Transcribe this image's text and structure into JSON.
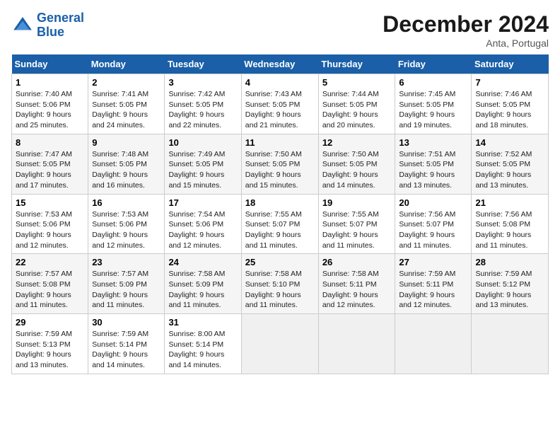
{
  "header": {
    "logo_line1": "General",
    "logo_line2": "Blue",
    "month_title": "December 2024",
    "location": "Anta, Portugal"
  },
  "weekdays": [
    "Sunday",
    "Monday",
    "Tuesday",
    "Wednesday",
    "Thursday",
    "Friday",
    "Saturday"
  ],
  "days": [
    {
      "num": "",
      "info": ""
    },
    {
      "num": "",
      "info": ""
    },
    {
      "num": "",
      "info": ""
    },
    {
      "num": "",
      "info": ""
    },
    {
      "num": "",
      "info": ""
    },
    {
      "num": "",
      "info": ""
    },
    {
      "num": "7",
      "info": "Sunrise: 7:46 AM\nSunset: 5:05 PM\nDaylight: 9 hours\nand 18 minutes."
    },
    {
      "num": "1",
      "info": "Sunrise: 7:40 AM\nSunset: 5:06 PM\nDaylight: 9 hours\nand 25 minutes."
    },
    {
      "num": "2",
      "info": "Sunrise: 7:41 AM\nSunset: 5:05 PM\nDaylight: 9 hours\nand 24 minutes."
    },
    {
      "num": "3",
      "info": "Sunrise: 7:42 AM\nSunset: 5:05 PM\nDaylight: 9 hours\nand 22 minutes."
    },
    {
      "num": "4",
      "info": "Sunrise: 7:43 AM\nSunset: 5:05 PM\nDaylight: 9 hours\nand 21 minutes."
    },
    {
      "num": "5",
      "info": "Sunrise: 7:44 AM\nSunset: 5:05 PM\nDaylight: 9 hours\nand 20 minutes."
    },
    {
      "num": "6",
      "info": "Sunrise: 7:45 AM\nSunset: 5:05 PM\nDaylight: 9 hours\nand 19 minutes."
    },
    {
      "num": "7",
      "info": "Sunrise: 7:46 AM\nSunset: 5:05 PM\nDaylight: 9 hours\nand 18 minutes."
    },
    {
      "num": "8",
      "info": "Sunrise: 7:47 AM\nSunset: 5:05 PM\nDaylight: 9 hours\nand 17 minutes."
    },
    {
      "num": "9",
      "info": "Sunrise: 7:48 AM\nSunset: 5:05 PM\nDaylight: 9 hours\nand 16 minutes."
    },
    {
      "num": "10",
      "info": "Sunrise: 7:49 AM\nSunset: 5:05 PM\nDaylight: 9 hours\nand 15 minutes."
    },
    {
      "num": "11",
      "info": "Sunrise: 7:50 AM\nSunset: 5:05 PM\nDaylight: 9 hours\nand 15 minutes."
    },
    {
      "num": "12",
      "info": "Sunrise: 7:50 AM\nSunset: 5:05 PM\nDaylight: 9 hours\nand 14 minutes."
    },
    {
      "num": "13",
      "info": "Sunrise: 7:51 AM\nSunset: 5:05 PM\nDaylight: 9 hours\nand 13 minutes."
    },
    {
      "num": "14",
      "info": "Sunrise: 7:52 AM\nSunset: 5:05 PM\nDaylight: 9 hours\nand 13 minutes."
    },
    {
      "num": "15",
      "info": "Sunrise: 7:53 AM\nSunset: 5:06 PM\nDaylight: 9 hours\nand 12 minutes."
    },
    {
      "num": "16",
      "info": "Sunrise: 7:53 AM\nSunset: 5:06 PM\nDaylight: 9 hours\nand 12 minutes."
    },
    {
      "num": "17",
      "info": "Sunrise: 7:54 AM\nSunset: 5:06 PM\nDaylight: 9 hours\nand 12 minutes."
    },
    {
      "num": "18",
      "info": "Sunrise: 7:55 AM\nSunset: 5:07 PM\nDaylight: 9 hours\nand 11 minutes."
    },
    {
      "num": "19",
      "info": "Sunrise: 7:55 AM\nSunset: 5:07 PM\nDaylight: 9 hours\nand 11 minutes."
    },
    {
      "num": "20",
      "info": "Sunrise: 7:56 AM\nSunset: 5:07 PM\nDaylight: 9 hours\nand 11 minutes."
    },
    {
      "num": "21",
      "info": "Sunrise: 7:56 AM\nSunset: 5:08 PM\nDaylight: 9 hours\nand 11 minutes."
    },
    {
      "num": "22",
      "info": "Sunrise: 7:57 AM\nSunset: 5:08 PM\nDaylight: 9 hours\nand 11 minutes."
    },
    {
      "num": "23",
      "info": "Sunrise: 7:57 AM\nSunset: 5:09 PM\nDaylight: 9 hours\nand 11 minutes."
    },
    {
      "num": "24",
      "info": "Sunrise: 7:58 AM\nSunset: 5:09 PM\nDaylight: 9 hours\nand 11 minutes."
    },
    {
      "num": "25",
      "info": "Sunrise: 7:58 AM\nSunset: 5:10 PM\nDaylight: 9 hours\nand 11 minutes."
    },
    {
      "num": "26",
      "info": "Sunrise: 7:58 AM\nSunset: 5:11 PM\nDaylight: 9 hours\nand 12 minutes."
    },
    {
      "num": "27",
      "info": "Sunrise: 7:59 AM\nSunset: 5:11 PM\nDaylight: 9 hours\nand 12 minutes."
    },
    {
      "num": "28",
      "info": "Sunrise: 7:59 AM\nSunset: 5:12 PM\nDaylight: 9 hours\nand 13 minutes."
    },
    {
      "num": "29",
      "info": "Sunrise: 7:59 AM\nSunset: 5:13 PM\nDaylight: 9 hours\nand 13 minutes."
    },
    {
      "num": "30",
      "info": "Sunrise: 7:59 AM\nSunset: 5:14 PM\nDaylight: 9 hours\nand 14 minutes."
    },
    {
      "num": "31",
      "info": "Sunrise: 8:00 AM\nSunset: 5:14 PM\nDaylight: 9 hours\nand 14 minutes."
    },
    {
      "num": "",
      "info": ""
    },
    {
      "num": "",
      "info": ""
    },
    {
      "num": "",
      "info": ""
    },
    {
      "num": "",
      "info": ""
    }
  ],
  "grid": [
    [
      {
        "num": "1",
        "info": "Sunrise: 7:40 AM\nSunset: 5:06 PM\nDaylight: 9 hours\nand 25 minutes."
      },
      {
        "num": "2",
        "info": "Sunrise: 7:41 AM\nSunset: 5:05 PM\nDaylight: 9 hours\nand 24 minutes."
      },
      {
        "num": "3",
        "info": "Sunrise: 7:42 AM\nSunset: 5:05 PM\nDaylight: 9 hours\nand 22 minutes."
      },
      {
        "num": "4",
        "info": "Sunrise: 7:43 AM\nSunset: 5:05 PM\nDaylight: 9 hours\nand 21 minutes."
      },
      {
        "num": "5",
        "info": "Sunrise: 7:44 AM\nSunset: 5:05 PM\nDaylight: 9 hours\nand 20 minutes."
      },
      {
        "num": "6",
        "info": "Sunrise: 7:45 AM\nSunset: 5:05 PM\nDaylight: 9 hours\nand 19 minutes."
      },
      {
        "num": "7",
        "info": "Sunrise: 7:46 AM\nSunset: 5:05 PM\nDaylight: 9 hours\nand 18 minutes."
      }
    ],
    [
      {
        "num": "8",
        "info": "Sunrise: 7:47 AM\nSunset: 5:05 PM\nDaylight: 9 hours\nand 17 minutes."
      },
      {
        "num": "9",
        "info": "Sunrise: 7:48 AM\nSunset: 5:05 PM\nDaylight: 9 hours\nand 16 minutes."
      },
      {
        "num": "10",
        "info": "Sunrise: 7:49 AM\nSunset: 5:05 PM\nDaylight: 9 hours\nand 15 minutes."
      },
      {
        "num": "11",
        "info": "Sunrise: 7:50 AM\nSunset: 5:05 PM\nDaylight: 9 hours\nand 15 minutes."
      },
      {
        "num": "12",
        "info": "Sunrise: 7:50 AM\nSunset: 5:05 PM\nDaylight: 9 hours\nand 14 minutes."
      },
      {
        "num": "13",
        "info": "Sunrise: 7:51 AM\nSunset: 5:05 PM\nDaylight: 9 hours\nand 13 minutes."
      },
      {
        "num": "14",
        "info": "Sunrise: 7:52 AM\nSunset: 5:05 PM\nDaylight: 9 hours\nand 13 minutes."
      }
    ],
    [
      {
        "num": "15",
        "info": "Sunrise: 7:53 AM\nSunset: 5:06 PM\nDaylight: 9 hours\nand 12 minutes."
      },
      {
        "num": "16",
        "info": "Sunrise: 7:53 AM\nSunset: 5:06 PM\nDaylight: 9 hours\nand 12 minutes."
      },
      {
        "num": "17",
        "info": "Sunrise: 7:54 AM\nSunset: 5:06 PM\nDaylight: 9 hours\nand 12 minutes."
      },
      {
        "num": "18",
        "info": "Sunrise: 7:55 AM\nSunset: 5:07 PM\nDaylight: 9 hours\nand 11 minutes."
      },
      {
        "num": "19",
        "info": "Sunrise: 7:55 AM\nSunset: 5:07 PM\nDaylight: 9 hours\nand 11 minutes."
      },
      {
        "num": "20",
        "info": "Sunrise: 7:56 AM\nSunset: 5:07 PM\nDaylight: 9 hours\nand 11 minutes."
      },
      {
        "num": "21",
        "info": "Sunrise: 7:56 AM\nSunset: 5:08 PM\nDaylight: 9 hours\nand 11 minutes."
      }
    ],
    [
      {
        "num": "22",
        "info": "Sunrise: 7:57 AM\nSunset: 5:08 PM\nDaylight: 9 hours\nand 11 minutes."
      },
      {
        "num": "23",
        "info": "Sunrise: 7:57 AM\nSunset: 5:09 PM\nDaylight: 9 hours\nand 11 minutes."
      },
      {
        "num": "24",
        "info": "Sunrise: 7:58 AM\nSunset: 5:09 PM\nDaylight: 9 hours\nand 11 minutes."
      },
      {
        "num": "25",
        "info": "Sunrise: 7:58 AM\nSunset: 5:10 PM\nDaylight: 9 hours\nand 11 minutes."
      },
      {
        "num": "26",
        "info": "Sunrise: 7:58 AM\nSunset: 5:11 PM\nDaylight: 9 hours\nand 12 minutes."
      },
      {
        "num": "27",
        "info": "Sunrise: 7:59 AM\nSunset: 5:11 PM\nDaylight: 9 hours\nand 12 minutes."
      },
      {
        "num": "28",
        "info": "Sunrise: 7:59 AM\nSunset: 5:12 PM\nDaylight: 9 hours\nand 13 minutes."
      }
    ],
    [
      {
        "num": "29",
        "info": "Sunrise: 7:59 AM\nSunset: 5:13 PM\nDaylight: 9 hours\nand 13 minutes."
      },
      {
        "num": "30",
        "info": "Sunrise: 7:59 AM\nSunset: 5:14 PM\nDaylight: 9 hours\nand 14 minutes."
      },
      {
        "num": "31",
        "info": "Sunrise: 8:00 AM\nSunset: 5:14 PM\nDaylight: 9 hours\nand 14 minutes."
      },
      {
        "num": "",
        "info": ""
      },
      {
        "num": "",
        "info": ""
      },
      {
        "num": "",
        "info": ""
      },
      {
        "num": "",
        "info": ""
      }
    ]
  ]
}
